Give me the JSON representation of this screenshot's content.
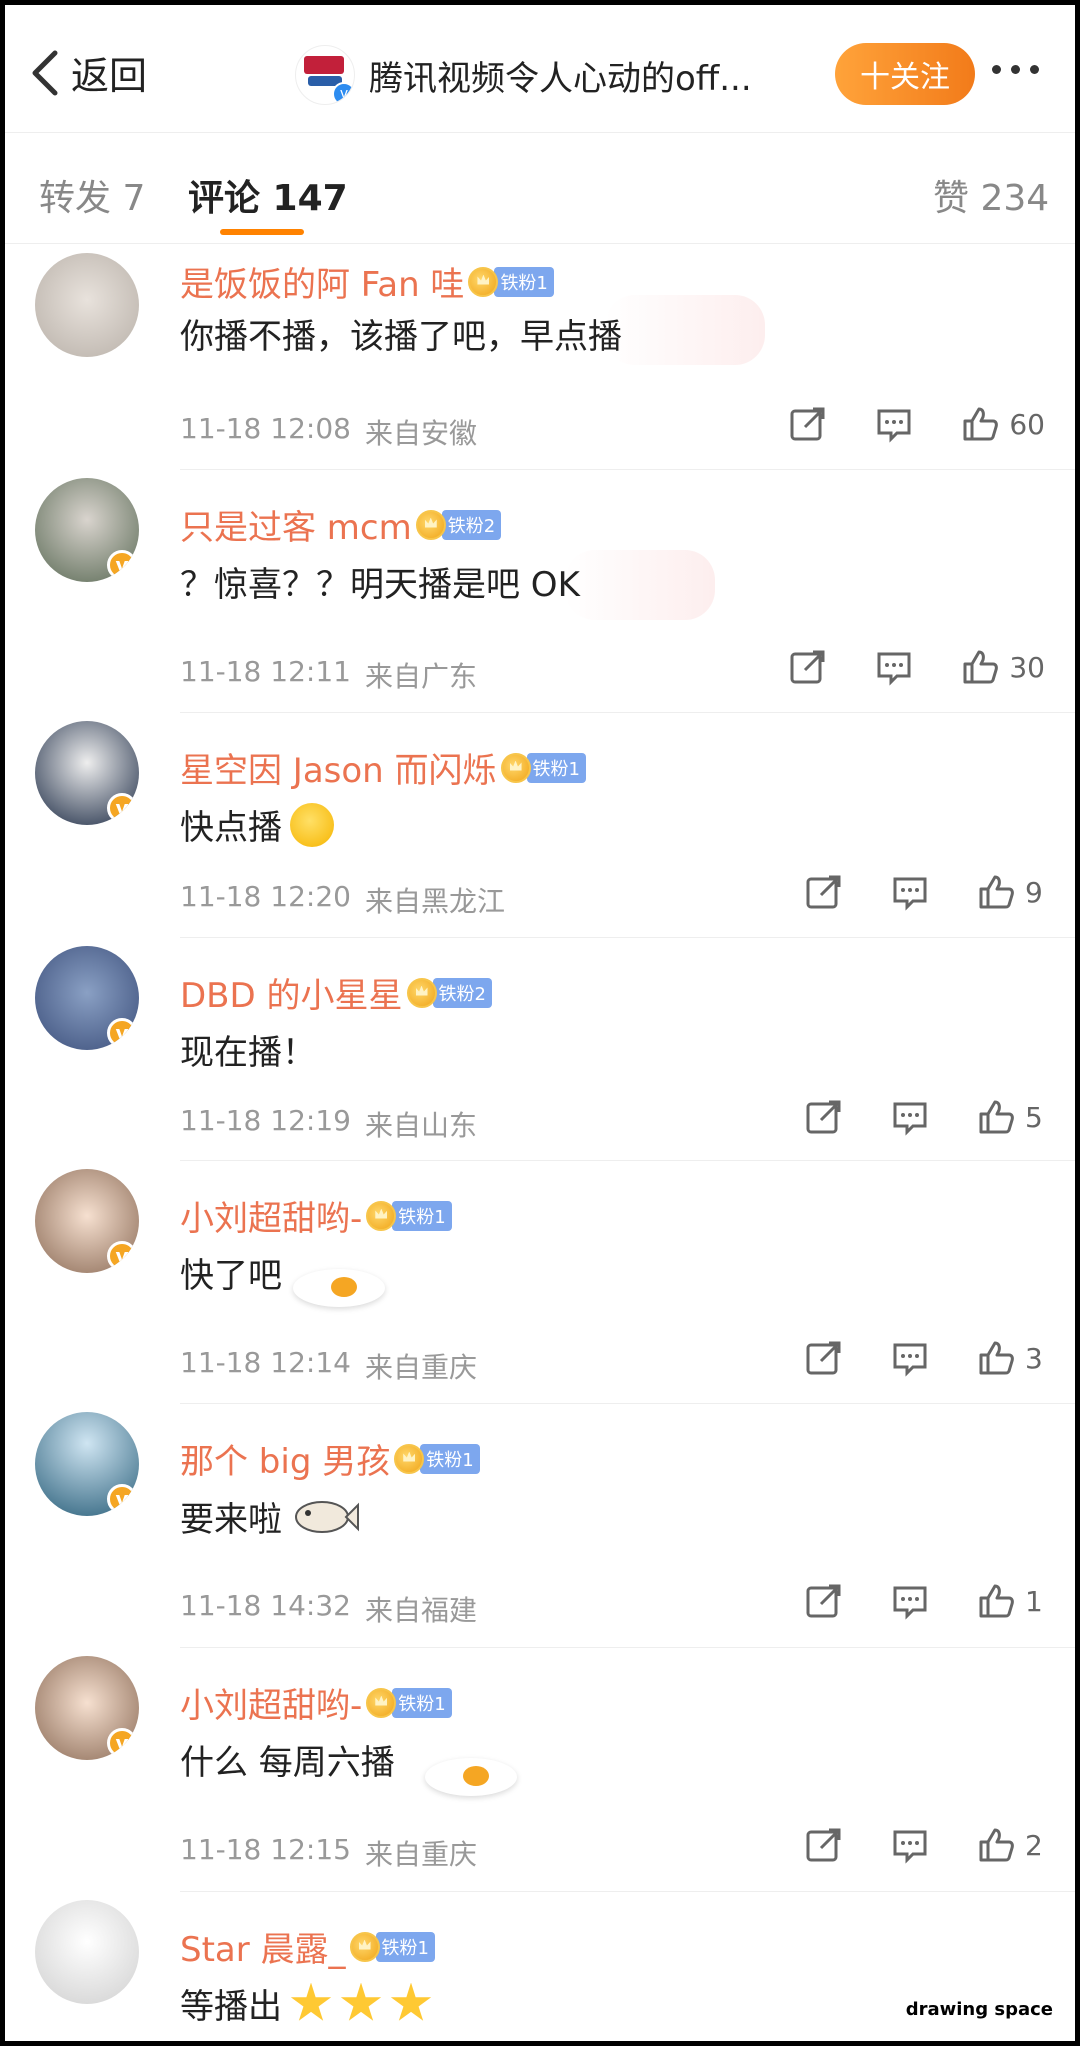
{
  "header": {
    "back_label": "返回",
    "title": "腾讯视频令人心动的off...",
    "follow_label": "十关注"
  },
  "tabs": {
    "repost": "转发 7",
    "comment": "评论 147",
    "like": "赞 234"
  },
  "comments": [
    {
      "user": "是饭饭的阿 Fan 哇",
      "fan": "铁粉1",
      "text": "你播不播，该播了吧，早点播",
      "time": "11-18 12:08",
      "from": "来自安徽",
      "likes": "60"
    },
    {
      "user": "只是过客 mcm",
      "fan": "铁粉2",
      "text": "？惊喜？？明天播是吧 OK",
      "time": "11-18 12:11",
      "from": "来自广东",
      "likes": "30"
    },
    {
      "user": "星空因 Jason 而闪烁",
      "fan": "铁粉1",
      "text": "快点播",
      "time": "11-18 12:20",
      "from": "来自黑龙江",
      "likes": "9"
    },
    {
      "user": "DBD 的小星星",
      "fan": "铁粉2",
      "text": "现在播！",
      "time": "11-18 12:19",
      "from": "来自山东",
      "likes": "5"
    },
    {
      "user": "小刘超甜哟-",
      "fan": "铁粉1",
      "text": "快了吧",
      "time": "11-18 12:14",
      "from": "来自重庆",
      "likes": "3"
    },
    {
      "user": "那个 big 男孩",
      "fan": "铁粉1",
      "text": "要来啦",
      "time": "11-18 14:32",
      "from": "来自福建",
      "likes": "1"
    },
    {
      "user": "小刘超甜哟-",
      "fan": "铁粉1",
      "text": "什么 每周六播",
      "time": "11-18 12:15",
      "from": "来自重庆",
      "likes": "2"
    },
    {
      "user": "Star 晨露_",
      "fan": "铁粉1",
      "text": "等播出"
    }
  ],
  "watermark": "drawing space",
  "colors": {
    "accent": "#ff8200",
    "username": "#eb7350",
    "fan_badge": "#7da7ee",
    "verified": "#f5a623"
  }
}
